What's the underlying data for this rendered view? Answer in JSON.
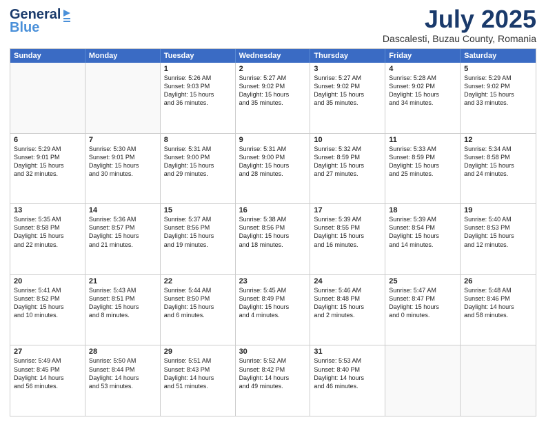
{
  "header": {
    "logo_general": "General",
    "logo_blue": "Blue",
    "month_title": "July 2025",
    "subtitle": "Dascalesti, Buzau County, Romania"
  },
  "weekdays": [
    "Sunday",
    "Monday",
    "Tuesday",
    "Wednesday",
    "Thursday",
    "Friday",
    "Saturday"
  ],
  "rows": [
    [
      {
        "day": "",
        "lines": []
      },
      {
        "day": "",
        "lines": []
      },
      {
        "day": "1",
        "lines": [
          "Sunrise: 5:26 AM",
          "Sunset: 9:03 PM",
          "Daylight: 15 hours",
          "and 36 minutes."
        ]
      },
      {
        "day": "2",
        "lines": [
          "Sunrise: 5:27 AM",
          "Sunset: 9:02 PM",
          "Daylight: 15 hours",
          "and 35 minutes."
        ]
      },
      {
        "day": "3",
        "lines": [
          "Sunrise: 5:27 AM",
          "Sunset: 9:02 PM",
          "Daylight: 15 hours",
          "and 35 minutes."
        ]
      },
      {
        "day": "4",
        "lines": [
          "Sunrise: 5:28 AM",
          "Sunset: 9:02 PM",
          "Daylight: 15 hours",
          "and 34 minutes."
        ]
      },
      {
        "day": "5",
        "lines": [
          "Sunrise: 5:29 AM",
          "Sunset: 9:02 PM",
          "Daylight: 15 hours",
          "and 33 minutes."
        ]
      }
    ],
    [
      {
        "day": "6",
        "lines": [
          "Sunrise: 5:29 AM",
          "Sunset: 9:01 PM",
          "Daylight: 15 hours",
          "and 32 minutes."
        ]
      },
      {
        "day": "7",
        "lines": [
          "Sunrise: 5:30 AM",
          "Sunset: 9:01 PM",
          "Daylight: 15 hours",
          "and 30 minutes."
        ]
      },
      {
        "day": "8",
        "lines": [
          "Sunrise: 5:31 AM",
          "Sunset: 9:00 PM",
          "Daylight: 15 hours",
          "and 29 minutes."
        ]
      },
      {
        "day": "9",
        "lines": [
          "Sunrise: 5:31 AM",
          "Sunset: 9:00 PM",
          "Daylight: 15 hours",
          "and 28 minutes."
        ]
      },
      {
        "day": "10",
        "lines": [
          "Sunrise: 5:32 AM",
          "Sunset: 8:59 PM",
          "Daylight: 15 hours",
          "and 27 minutes."
        ]
      },
      {
        "day": "11",
        "lines": [
          "Sunrise: 5:33 AM",
          "Sunset: 8:59 PM",
          "Daylight: 15 hours",
          "and 25 minutes."
        ]
      },
      {
        "day": "12",
        "lines": [
          "Sunrise: 5:34 AM",
          "Sunset: 8:58 PM",
          "Daylight: 15 hours",
          "and 24 minutes."
        ]
      }
    ],
    [
      {
        "day": "13",
        "lines": [
          "Sunrise: 5:35 AM",
          "Sunset: 8:58 PM",
          "Daylight: 15 hours",
          "and 22 minutes."
        ]
      },
      {
        "day": "14",
        "lines": [
          "Sunrise: 5:36 AM",
          "Sunset: 8:57 PM",
          "Daylight: 15 hours",
          "and 21 minutes."
        ]
      },
      {
        "day": "15",
        "lines": [
          "Sunrise: 5:37 AM",
          "Sunset: 8:56 PM",
          "Daylight: 15 hours",
          "and 19 minutes."
        ]
      },
      {
        "day": "16",
        "lines": [
          "Sunrise: 5:38 AM",
          "Sunset: 8:56 PM",
          "Daylight: 15 hours",
          "and 18 minutes."
        ]
      },
      {
        "day": "17",
        "lines": [
          "Sunrise: 5:39 AM",
          "Sunset: 8:55 PM",
          "Daylight: 15 hours",
          "and 16 minutes."
        ]
      },
      {
        "day": "18",
        "lines": [
          "Sunrise: 5:39 AM",
          "Sunset: 8:54 PM",
          "Daylight: 15 hours",
          "and 14 minutes."
        ]
      },
      {
        "day": "19",
        "lines": [
          "Sunrise: 5:40 AM",
          "Sunset: 8:53 PM",
          "Daylight: 15 hours",
          "and 12 minutes."
        ]
      }
    ],
    [
      {
        "day": "20",
        "lines": [
          "Sunrise: 5:41 AM",
          "Sunset: 8:52 PM",
          "Daylight: 15 hours",
          "and 10 minutes."
        ]
      },
      {
        "day": "21",
        "lines": [
          "Sunrise: 5:43 AM",
          "Sunset: 8:51 PM",
          "Daylight: 15 hours",
          "and 8 minutes."
        ]
      },
      {
        "day": "22",
        "lines": [
          "Sunrise: 5:44 AM",
          "Sunset: 8:50 PM",
          "Daylight: 15 hours",
          "and 6 minutes."
        ]
      },
      {
        "day": "23",
        "lines": [
          "Sunrise: 5:45 AM",
          "Sunset: 8:49 PM",
          "Daylight: 15 hours",
          "and 4 minutes."
        ]
      },
      {
        "day": "24",
        "lines": [
          "Sunrise: 5:46 AM",
          "Sunset: 8:48 PM",
          "Daylight: 15 hours",
          "and 2 minutes."
        ]
      },
      {
        "day": "25",
        "lines": [
          "Sunrise: 5:47 AM",
          "Sunset: 8:47 PM",
          "Daylight: 15 hours",
          "and 0 minutes."
        ]
      },
      {
        "day": "26",
        "lines": [
          "Sunrise: 5:48 AM",
          "Sunset: 8:46 PM",
          "Daylight: 14 hours",
          "and 58 minutes."
        ]
      }
    ],
    [
      {
        "day": "27",
        "lines": [
          "Sunrise: 5:49 AM",
          "Sunset: 8:45 PM",
          "Daylight: 14 hours",
          "and 56 minutes."
        ]
      },
      {
        "day": "28",
        "lines": [
          "Sunrise: 5:50 AM",
          "Sunset: 8:44 PM",
          "Daylight: 14 hours",
          "and 53 minutes."
        ]
      },
      {
        "day": "29",
        "lines": [
          "Sunrise: 5:51 AM",
          "Sunset: 8:43 PM",
          "Daylight: 14 hours",
          "and 51 minutes."
        ]
      },
      {
        "day": "30",
        "lines": [
          "Sunrise: 5:52 AM",
          "Sunset: 8:42 PM",
          "Daylight: 14 hours",
          "and 49 minutes."
        ]
      },
      {
        "day": "31",
        "lines": [
          "Sunrise: 5:53 AM",
          "Sunset: 8:40 PM",
          "Daylight: 14 hours",
          "and 46 minutes."
        ]
      },
      {
        "day": "",
        "lines": []
      },
      {
        "day": "",
        "lines": []
      }
    ]
  ]
}
